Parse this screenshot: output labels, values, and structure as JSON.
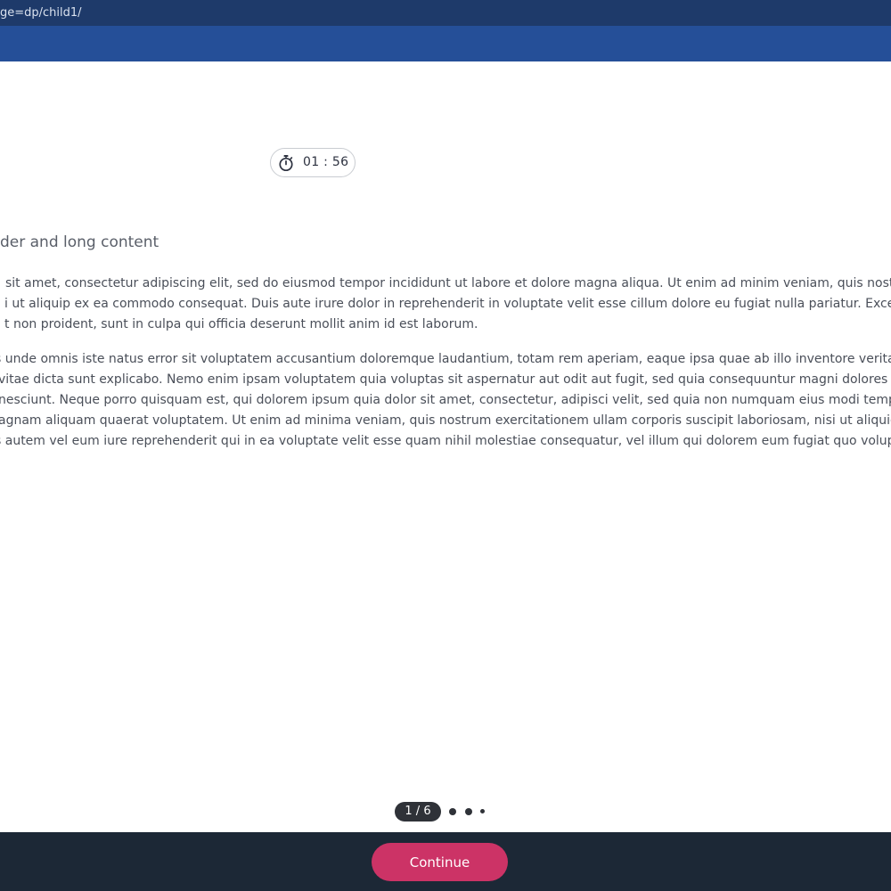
{
  "browser": {
    "url_fragment": "ge=dp/child1/"
  },
  "timer": {
    "icon": "stopwatch-icon",
    "time": "01 : 56"
  },
  "content": {
    "title": "der and long content",
    "paragraph1": [
      "sit amet, consectetur adipiscing elit, sed do eiusmod tempor incididunt ut labore et dolore magna aliqua. Ut enim ad minim veniam, quis nostru",
      "i ut aliquip ex ea commodo consequat. Duis aute irure dolor in reprehenderit in voluptate velit esse cillum dolore eu fugiat nulla pariatur. Except",
      "t non proident, sunt in culpa qui officia deserunt mollit anim id est laborum."
    ],
    "paragraph2": [
      "s unde omnis iste natus error sit voluptatem accusantium doloremque laudantium, totam rem aperiam, eaque ipsa quae ab illo inventore veritat",
      "vitae dicta sunt explicabo. Nemo enim ipsam voluptatem quia voluptas sit aspernatur aut odit aut fugit, sed quia consequuntur magni dolores e",
      "nesciunt. Neque porro quisquam est, qui dolorem ipsum quia dolor sit amet, consectetur, adipisci velit, sed quia non numquam eius modi tempo",
      "agnam aliquam quaerat voluptatem. Ut enim ad minima veniam, quis nostrum exercitationem ullam corporis suscipit laboriosam, nisi ut aliquid e",
      "s autem vel eum iure reprehenderit qui in ea voluptate velit esse quam nihil molestiae consequatur, vel illum qui dolorem eum fugiat quo volupta"
    ]
  },
  "pager": {
    "label": "1 / 6"
  },
  "footer": {
    "continue_label": "Continue"
  },
  "colors": {
    "url_bar": "#1e3a6a",
    "header": "#254f98",
    "footer": "#1c2836",
    "accent": "#cc3366"
  }
}
